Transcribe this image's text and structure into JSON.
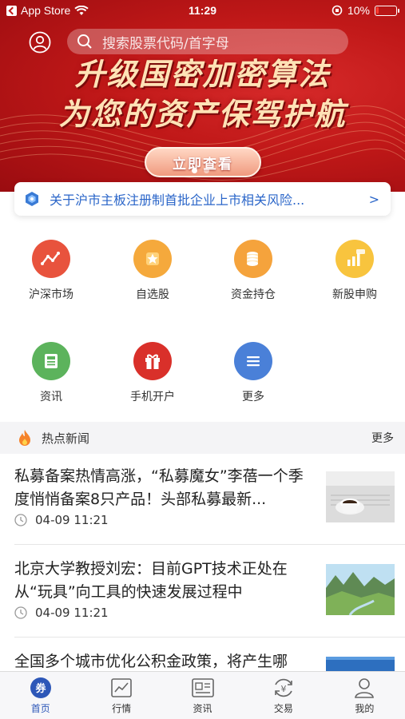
{
  "status_bar": {
    "back_app": "App Store",
    "time": "11:29",
    "battery": "10%"
  },
  "search": {
    "placeholder": "搜索股票代码/首字母"
  },
  "banner": {
    "headline_line1": "升级国密加密算法",
    "headline_line2": "为您的资产保驾护航",
    "cta": "立即查看",
    "pager": {
      "count": 2,
      "active": 1
    }
  },
  "notice": {
    "text": "关于沪市主板注册制首批企业上市相关风险...",
    "arrow": ">"
  },
  "grid": [
    {
      "label": "沪深市场",
      "icon": "market-trend-icon",
      "color": "#e8533d"
    },
    {
      "label": "自选股",
      "icon": "star-icon",
      "color": "#f5a93c"
    },
    {
      "label": "资金持仓",
      "icon": "coins-icon",
      "color": "#f5a33c"
    },
    {
      "label": "新股申购",
      "icon": "new-stock-icon",
      "color": "#f8c43e"
    },
    {
      "label": "资讯",
      "icon": "news-icon",
      "color": "#5cb35c"
    },
    {
      "label": "手机开户",
      "icon": "gift-icon",
      "color": "#d9302a"
    },
    {
      "label": "更多",
      "icon": "more-menu-icon",
      "color": "#4a80d8"
    }
  ],
  "hot_news": {
    "title": "热点新闻",
    "more": "更多",
    "items": [
      {
        "title": "私募备案热情高涨，“私募魔女”李蓓一个季度悄悄备案8只产品！头部私募最新...",
        "time": "04-09 11:21"
      },
      {
        "title": "北京大学教授刘宏：目前GPT技术正处在从“玩具”向工具的快速发展过程中",
        "time": "04-09 11:21"
      },
      {
        "title": "全国多个城市优化公积金政策，将产生哪",
        "time": ""
      }
    ]
  },
  "tabbar": [
    {
      "label": "首页",
      "icon": "home-badge-icon",
      "active": true
    },
    {
      "label": "行情",
      "icon": "chart-icon",
      "active": false
    },
    {
      "label": "资讯",
      "icon": "news-card-icon",
      "active": false
    },
    {
      "label": "交易",
      "icon": "yuan-exchange-icon",
      "active": false
    },
    {
      "label": "我的",
      "icon": "profile-icon",
      "active": false
    }
  ],
  "colors": {
    "brand_red": "#c01818",
    "accent_blue": "#2d57b8",
    "notice_blue": "#2b66c9",
    "headline_gold": "#ffe2b6"
  }
}
